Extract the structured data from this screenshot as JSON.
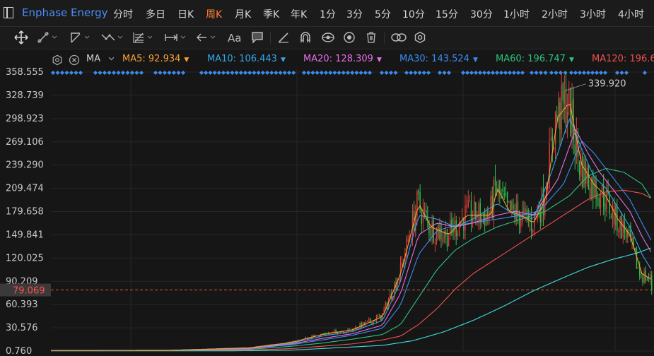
{
  "header": {
    "symbol": "Enphase Energy",
    "intervals": [
      "分时",
      "多日",
      "日K",
      "周K",
      "月K",
      "季K",
      "年K",
      "1分",
      "3分",
      "5分",
      "10分",
      "15分",
      "30分",
      "1小时",
      "2小时",
      "3小时",
      "4小时"
    ],
    "active_interval": "周K"
  },
  "toolbar": {
    "tools": [
      "crosshair-icon",
      "line-tool-icon",
      "channel-tool-icon",
      "pattern-tool-icon",
      "fibonacci-tool-icon",
      "measure-tool-icon",
      "arrow-tool-icon",
      "text-tool-icon",
      "comment-tool-icon",
      "brush-icon",
      "magnet-icon",
      "visibility-icon",
      "lock-icon",
      "trash-icon",
      "link-icon",
      "settings-icon"
    ]
  },
  "indicator": {
    "name": "MA",
    "lines": [
      {
        "label": "MA5:",
        "value": "92.934",
        "color": "#f7a035"
      },
      {
        "label": "MA10:",
        "value": "106.443",
        "color": "#33a6e8"
      },
      {
        "label": "MA20:",
        "value": "128.309",
        "color": "#e96ee4"
      },
      {
        "label": "MA30:",
        "value": "143.524",
        "color": "#3a8cf0"
      },
      {
        "label": "MA60:",
        "value": "196.747",
        "color": "#2ec27e"
      },
      {
        "label": "MA120:",
        "value": "196.6",
        "color": "#f05050"
      }
    ]
  },
  "colors": {
    "up": "#e03c3c",
    "down": "#2fbf50",
    "ma5": "#f7a035",
    "ma10": "#33a6e8",
    "ma20": "#e96ee4",
    "ma30": "#3a8cf0",
    "ma60": "#2ec27e",
    "ma120": "#f05050",
    "ma250": "#3ce0e0",
    "marker": "#3a8cf0"
  },
  "chart_data": {
    "type": "candlestick",
    "y_ticks": [
      "358.555",
      "328.739",
      "298.923",
      "269.106",
      "239.290",
      "209.474",
      "179.658",
      "149.841",
      "120.025",
      "90.209",
      "60.393",
      "30.576",
      "0.760"
    ],
    "ylim": [
      0.76,
      358.555
    ],
    "max_label": "339.920",
    "max_value": 339.92,
    "current_price": "79.069",
    "current_value": 79.069,
    "grid": true,
    "ma_trend": {
      "ma5": [
        [
          0,
          1.5
        ],
        [
          0.2,
          1.8
        ],
        [
          0.33,
          5
        ],
        [
          0.4,
          12
        ],
        [
          0.45,
          22
        ],
        [
          0.5,
          28
        ],
        [
          0.55,
          45
        ],
        [
          0.58,
          100
        ],
        [
          0.61,
          190
        ],
        [
          0.63,
          160
        ],
        [
          0.66,
          150
        ],
        [
          0.69,
          175
        ],
        [
          0.72,
          175
        ],
        [
          0.73,
          175
        ],
        [
          0.74,
          210
        ],
        [
          0.76,
          180
        ],
        [
          0.78,
          175
        ],
        [
          0.8,
          165
        ],
        [
          0.82,
          195
        ],
        [
          0.84,
          300
        ],
        [
          0.86,
          320
        ],
        [
          0.88,
          240
        ],
        [
          0.9,
          215
        ],
        [
          0.92,
          200
        ],
        [
          0.94,
          170
        ],
        [
          0.96,
          150
        ],
        [
          0.98,
          100
        ],
        [
          0.995,
          93
        ]
      ],
      "ma10": [
        [
          0,
          1.5
        ],
        [
          0.2,
          1.8
        ],
        [
          0.33,
          5
        ],
        [
          0.4,
          11
        ],
        [
          0.45,
          20
        ],
        [
          0.5,
          26
        ],
        [
          0.55,
          40
        ],
        [
          0.58,
          90
        ],
        [
          0.61,
          175
        ],
        [
          0.64,
          170
        ],
        [
          0.67,
          160
        ],
        [
          0.7,
          170
        ],
        [
          0.74,
          190
        ],
        [
          0.77,
          175
        ],
        [
          0.8,
          170
        ],
        [
          0.83,
          230
        ],
        [
          0.86,
          300
        ],
        [
          0.88,
          260
        ],
        [
          0.9,
          225
        ],
        [
          0.92,
          210
        ],
        [
          0.94,
          185
        ],
        [
          0.96,
          160
        ],
        [
          0.98,
          125
        ],
        [
          0.995,
          106
        ]
      ],
      "ma20": [
        [
          0,
          1.5
        ],
        [
          0.2,
          1.7
        ],
        [
          0.33,
          4
        ],
        [
          0.4,
          10
        ],
        [
          0.45,
          17
        ],
        [
          0.5,
          23
        ],
        [
          0.55,
          34
        ],
        [
          0.58,
          75
        ],
        [
          0.61,
          150
        ],
        [
          0.64,
          165
        ],
        [
          0.67,
          160
        ],
        [
          0.7,
          165
        ],
        [
          0.74,
          175
        ],
        [
          0.77,
          180
        ],
        [
          0.8,
          175
        ],
        [
          0.84,
          220
        ],
        [
          0.87,
          285
        ],
        [
          0.89,
          255
        ],
        [
          0.91,
          230
        ],
        [
          0.93,
          210
        ],
        [
          0.96,
          180
        ],
        [
          0.98,
          148
        ],
        [
          0.995,
          128
        ]
      ],
      "ma30": [
        [
          0,
          1.5
        ],
        [
          0.2,
          1.7
        ],
        [
          0.33,
          4
        ],
        [
          0.4,
          9
        ],
        [
          0.45,
          15
        ],
        [
          0.5,
          21
        ],
        [
          0.55,
          30
        ],
        [
          0.58,
          60
        ],
        [
          0.61,
          125
        ],
        [
          0.64,
          155
        ],
        [
          0.67,
          162
        ],
        [
          0.7,
          165
        ],
        [
          0.74,
          170
        ],
        [
          0.78,
          175
        ],
        [
          0.81,
          180
        ],
        [
          0.85,
          215
        ],
        [
          0.88,
          270
        ],
        [
          0.9,
          255
        ],
        [
          0.92,
          235
        ],
        [
          0.94,
          215
        ],
        [
          0.96,
          195
        ],
        [
          0.98,
          165
        ],
        [
          0.995,
          143
        ]
      ],
      "ma60": [
        [
          0,
          1.5
        ],
        [
          0.2,
          1.6
        ],
        [
          0.33,
          3
        ],
        [
          0.4,
          7
        ],
        [
          0.45,
          11
        ],
        [
          0.5,
          16
        ],
        [
          0.55,
          22
        ],
        [
          0.58,
          35
        ],
        [
          0.61,
          70
        ],
        [
          0.64,
          105
        ],
        [
          0.67,
          130
        ],
        [
          0.7,
          145
        ],
        [
          0.74,
          160
        ],
        [
          0.78,
          170
        ],
        [
          0.82,
          180
        ],
        [
          0.86,
          200
        ],
        [
          0.89,
          225
        ],
        [
          0.92,
          235
        ],
        [
          0.95,
          230
        ],
        [
          0.98,
          215
        ],
        [
          0.995,
          197
        ]
      ],
      "ma120": [
        [
          0,
          1.5
        ],
        [
          0.2,
          1.5
        ],
        [
          0.33,
          2
        ],
        [
          0.4,
          4
        ],
        [
          0.45,
          7
        ],
        [
          0.5,
          10
        ],
        [
          0.55,
          15
        ],
        [
          0.58,
          20
        ],
        [
          0.61,
          35
        ],
        [
          0.64,
          55
        ],
        [
          0.67,
          80
        ],
        [
          0.7,
          100
        ],
        [
          0.74,
          120
        ],
        [
          0.78,
          140
        ],
        [
          0.82,
          160
        ],
        [
          0.86,
          180
        ],
        [
          0.89,
          195
        ],
        [
          0.92,
          205
        ],
        [
          0.95,
          207
        ],
        [
          0.98,
          203
        ],
        [
          0.995,
          197
        ]
      ],
      "ma250": [
        [
          0,
          1
        ],
        [
          0.3,
          1
        ],
        [
          0.4,
          2
        ],
        [
          0.45,
          4
        ],
        [
          0.5,
          6
        ],
        [
          0.55,
          8
        ],
        [
          0.6,
          14
        ],
        [
          0.65,
          25
        ],
        [
          0.7,
          40
        ],
        [
          0.75,
          58
        ],
        [
          0.8,
          78
        ],
        [
          0.85,
          95
        ],
        [
          0.89,
          108
        ],
        [
          0.93,
          118
        ],
        [
          0.97,
          126
        ],
        [
          0.995,
          133
        ]
      ]
    }
  }
}
